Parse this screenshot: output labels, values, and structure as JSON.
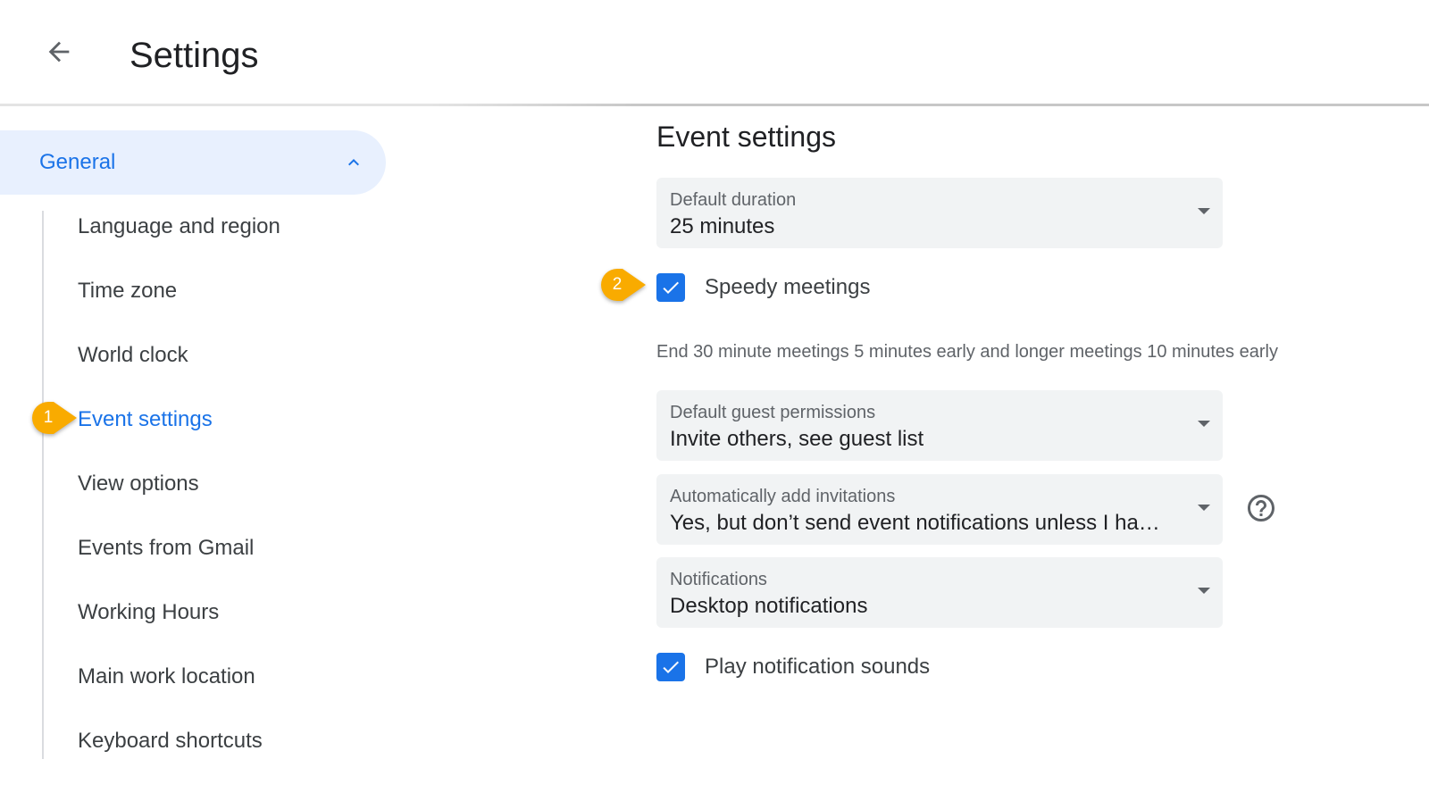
{
  "header": {
    "title": "Settings",
    "back_icon": "arrow-left-icon"
  },
  "sidebar": {
    "general": {
      "label": "General",
      "expanded": true,
      "icon": "chevron-up-icon"
    },
    "items": [
      {
        "label": "Language and region"
      },
      {
        "label": "Time zone"
      },
      {
        "label": "World clock"
      },
      {
        "label": "Event settings",
        "active": true
      },
      {
        "label": "View options"
      },
      {
        "label": "Events from Gmail"
      },
      {
        "label": "Working Hours"
      },
      {
        "label": "Main work location"
      },
      {
        "label": "Keyboard shortcuts"
      }
    ]
  },
  "callouts": {
    "one": "1",
    "two": "2",
    "color": "#f9ab00"
  },
  "main": {
    "title": "Event settings",
    "default_duration": {
      "label": "Default duration",
      "value": "25 minutes"
    },
    "speedy_meetings": {
      "label": "Speedy meetings",
      "checked": true,
      "helper": "End 30 minute meetings 5 minutes early and longer meetings 10 minutes early"
    },
    "guest_permissions": {
      "label": "Default guest permissions",
      "value": "Invite others, see guest list"
    },
    "auto_add": {
      "label": "Automatically add invitations",
      "value": "Yes, but don’t send event notifications unless I ha…",
      "help_icon": "help-circle-icon"
    },
    "notifications": {
      "label": "Notifications",
      "value": "Desktop notifications"
    },
    "play_sounds": {
      "label": "Play notification sounds",
      "checked": true
    }
  },
  "colors": {
    "accent": "#1a73e8",
    "selected_bg": "#e8f0fe",
    "field_bg": "#f1f3f4"
  }
}
